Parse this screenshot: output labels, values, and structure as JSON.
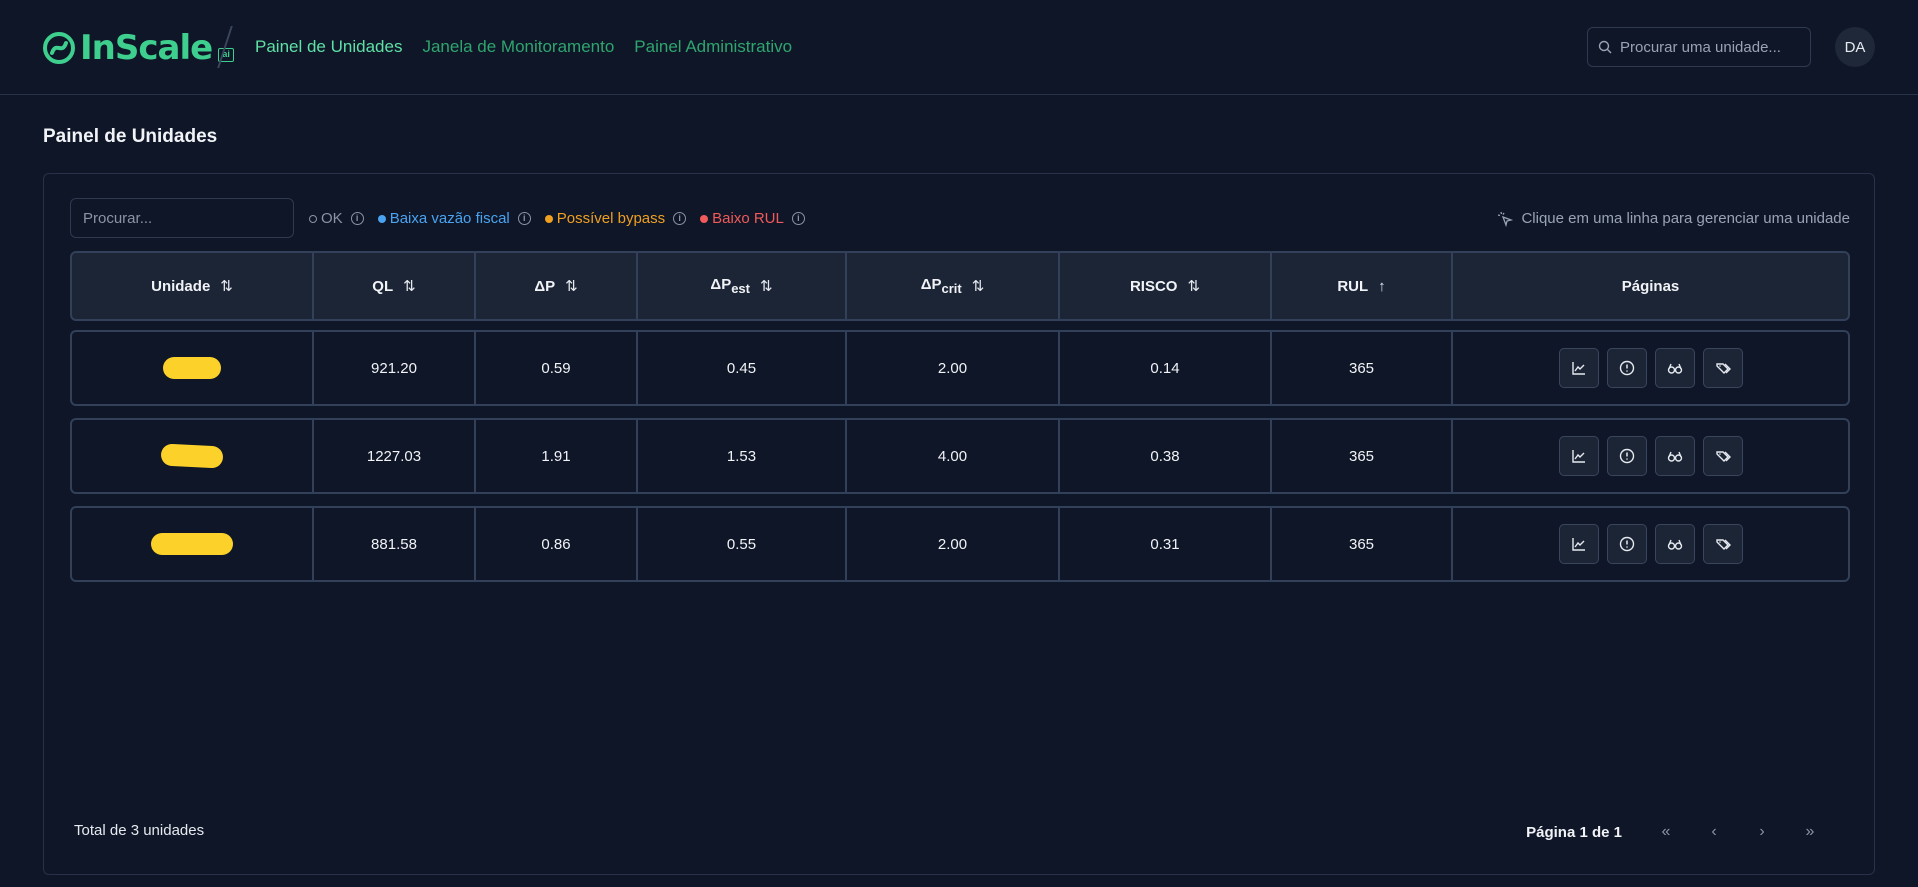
{
  "header": {
    "brand": "InScale",
    "brand_badge": "ai",
    "nav": [
      {
        "label": "Painel de Unidades",
        "active": true
      },
      {
        "label": "Janela de Monitoramento",
        "active": false
      },
      {
        "label": "Painel Administrativo",
        "active": false
      }
    ],
    "search_placeholder": "Procurar uma unidade...",
    "avatar_initials": "DA"
  },
  "page": {
    "title": "Painel de Unidades",
    "filter_placeholder": "Procurar...",
    "legend": [
      {
        "label": "OK",
        "color": "#8b93a5",
        "hollow": true
      },
      {
        "label": "Baixa vazão fiscal",
        "color": "#4aa3f0"
      },
      {
        "label": "Possível bypass",
        "color": "#f0a020"
      },
      {
        "label": "Baixo RUL",
        "color": "#f05a5a"
      }
    ],
    "hint": "Clique em uma linha para gerenciar uma unidade"
  },
  "table": {
    "columns": [
      {
        "label": "Unidade",
        "sub": "",
        "sort": "both"
      },
      {
        "label": "QL",
        "sub": "",
        "sort": "both"
      },
      {
        "label": "ΔP",
        "sub": "",
        "sort": "both"
      },
      {
        "label": "ΔP",
        "sub": "est",
        "sort": "both"
      },
      {
        "label": "ΔP",
        "sub": "crit",
        "sort": "both"
      },
      {
        "label": "RISCO",
        "sub": "",
        "sort": "both"
      },
      {
        "label": "RUL",
        "sub": "",
        "sort": "asc"
      },
      {
        "label": "Páginas",
        "sub": "",
        "sort": "none"
      }
    ],
    "rows": [
      {
        "ql": "921.20",
        "dp": "0.59",
        "dp_est": "0.45",
        "dp_crit": "2.00",
        "risco": "0.14",
        "rul": "365"
      },
      {
        "ql": "1227.03",
        "dp": "1.91",
        "dp_est": "1.53",
        "dp_crit": "4.00",
        "risco": "0.38",
        "rul": "365"
      },
      {
        "ql": "881.58",
        "dp": "0.86",
        "dp_est": "0.55",
        "dp_crit": "2.00",
        "risco": "0.31",
        "rul": "365"
      }
    ],
    "row_actions": [
      "chart-icon",
      "alert-circle-icon",
      "glasses-icon",
      "tags-icon"
    ]
  },
  "footer": {
    "total": "Total de 3 unidades",
    "page_label": "Página 1 de 1"
  },
  "colors": {
    "background": "#0e1627",
    "accent": "#3ecf8e",
    "redaction": "#fcd12a"
  }
}
